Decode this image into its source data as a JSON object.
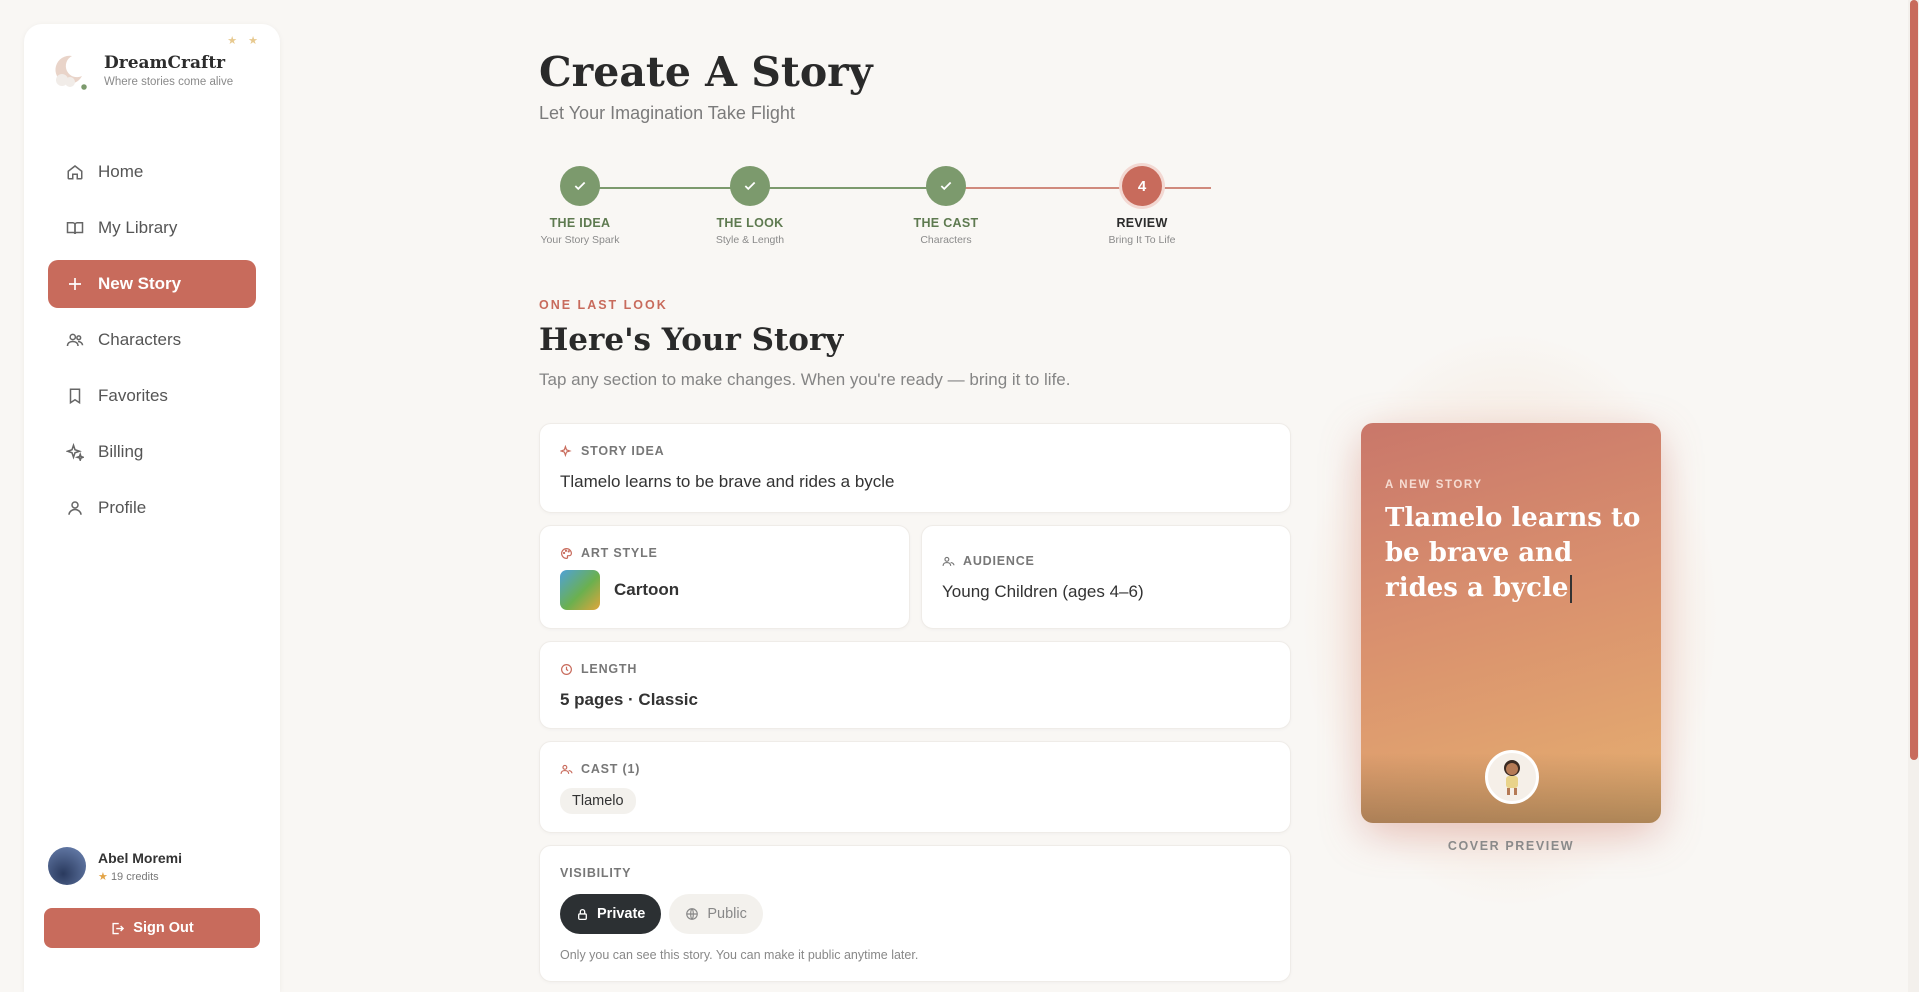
{
  "brand": {
    "name": "DreamCraftr",
    "tagline": "Where stories come alive",
    "decoration": "★ ★"
  },
  "nav": [
    {
      "label": "Home",
      "icon": "home-icon"
    },
    {
      "label": "My Library",
      "icon": "book-icon"
    },
    {
      "label": "New Story",
      "icon": "plus-icon",
      "active": true
    },
    {
      "label": "Characters",
      "icon": "users-icon"
    },
    {
      "label": "Favorites",
      "icon": "bookmark-icon"
    },
    {
      "label": "Billing",
      "icon": "sparkle-icon"
    },
    {
      "label": "Profile",
      "icon": "user-icon"
    }
  ],
  "user": {
    "name": "Abel Moremi",
    "credits": "19 credits"
  },
  "signout": {
    "label": "Sign Out"
  },
  "page": {
    "title": "Create A Story",
    "subtitle": "Let Your Imagination Take Flight"
  },
  "steps": [
    {
      "label": "THE IDEA",
      "sub": "Your Story Spark",
      "status": "done"
    },
    {
      "label": "THE LOOK",
      "sub": "Style & Length",
      "status": "done"
    },
    {
      "label": "THE CAST",
      "sub": "Characters",
      "status": "done"
    },
    {
      "label": "REVIEW",
      "sub": "Bring It To Life",
      "status": "current",
      "number": "4"
    }
  ],
  "review": {
    "eyebrow": "ONE LAST LOOK",
    "heading": "Here's Your Story",
    "description": "Tap any section to make changes. When you're ready — bring it to life."
  },
  "story_idea": {
    "label": "STORY IDEA",
    "value": "Tlamelo learns to be brave and rides a bycle"
  },
  "art_style": {
    "label": "ART STYLE",
    "value": "Cartoon"
  },
  "audience": {
    "label": "AUDIENCE",
    "value": "Young Children (ages 4–6)"
  },
  "length": {
    "label": "LENGTH",
    "value": "5 pages · Classic"
  },
  "cast": {
    "label": "CAST (1)",
    "members": [
      "Tlamelo"
    ]
  },
  "visibility": {
    "label": "VISIBILITY",
    "private_label": "Private",
    "public_label": "Public",
    "selected": "Private",
    "help": "Only you can see this story. You can make it public anytime later."
  },
  "cover": {
    "eyebrow": "A NEW STORY",
    "title": "Tlamelo learns to be brave and rides a bycle",
    "caption": "COVER PREVIEW"
  },
  "colors": {
    "accent": "#c86b5c",
    "done": "#7c9a6d",
    "dark": "#2c3033",
    "background": "#f9f7f4"
  }
}
